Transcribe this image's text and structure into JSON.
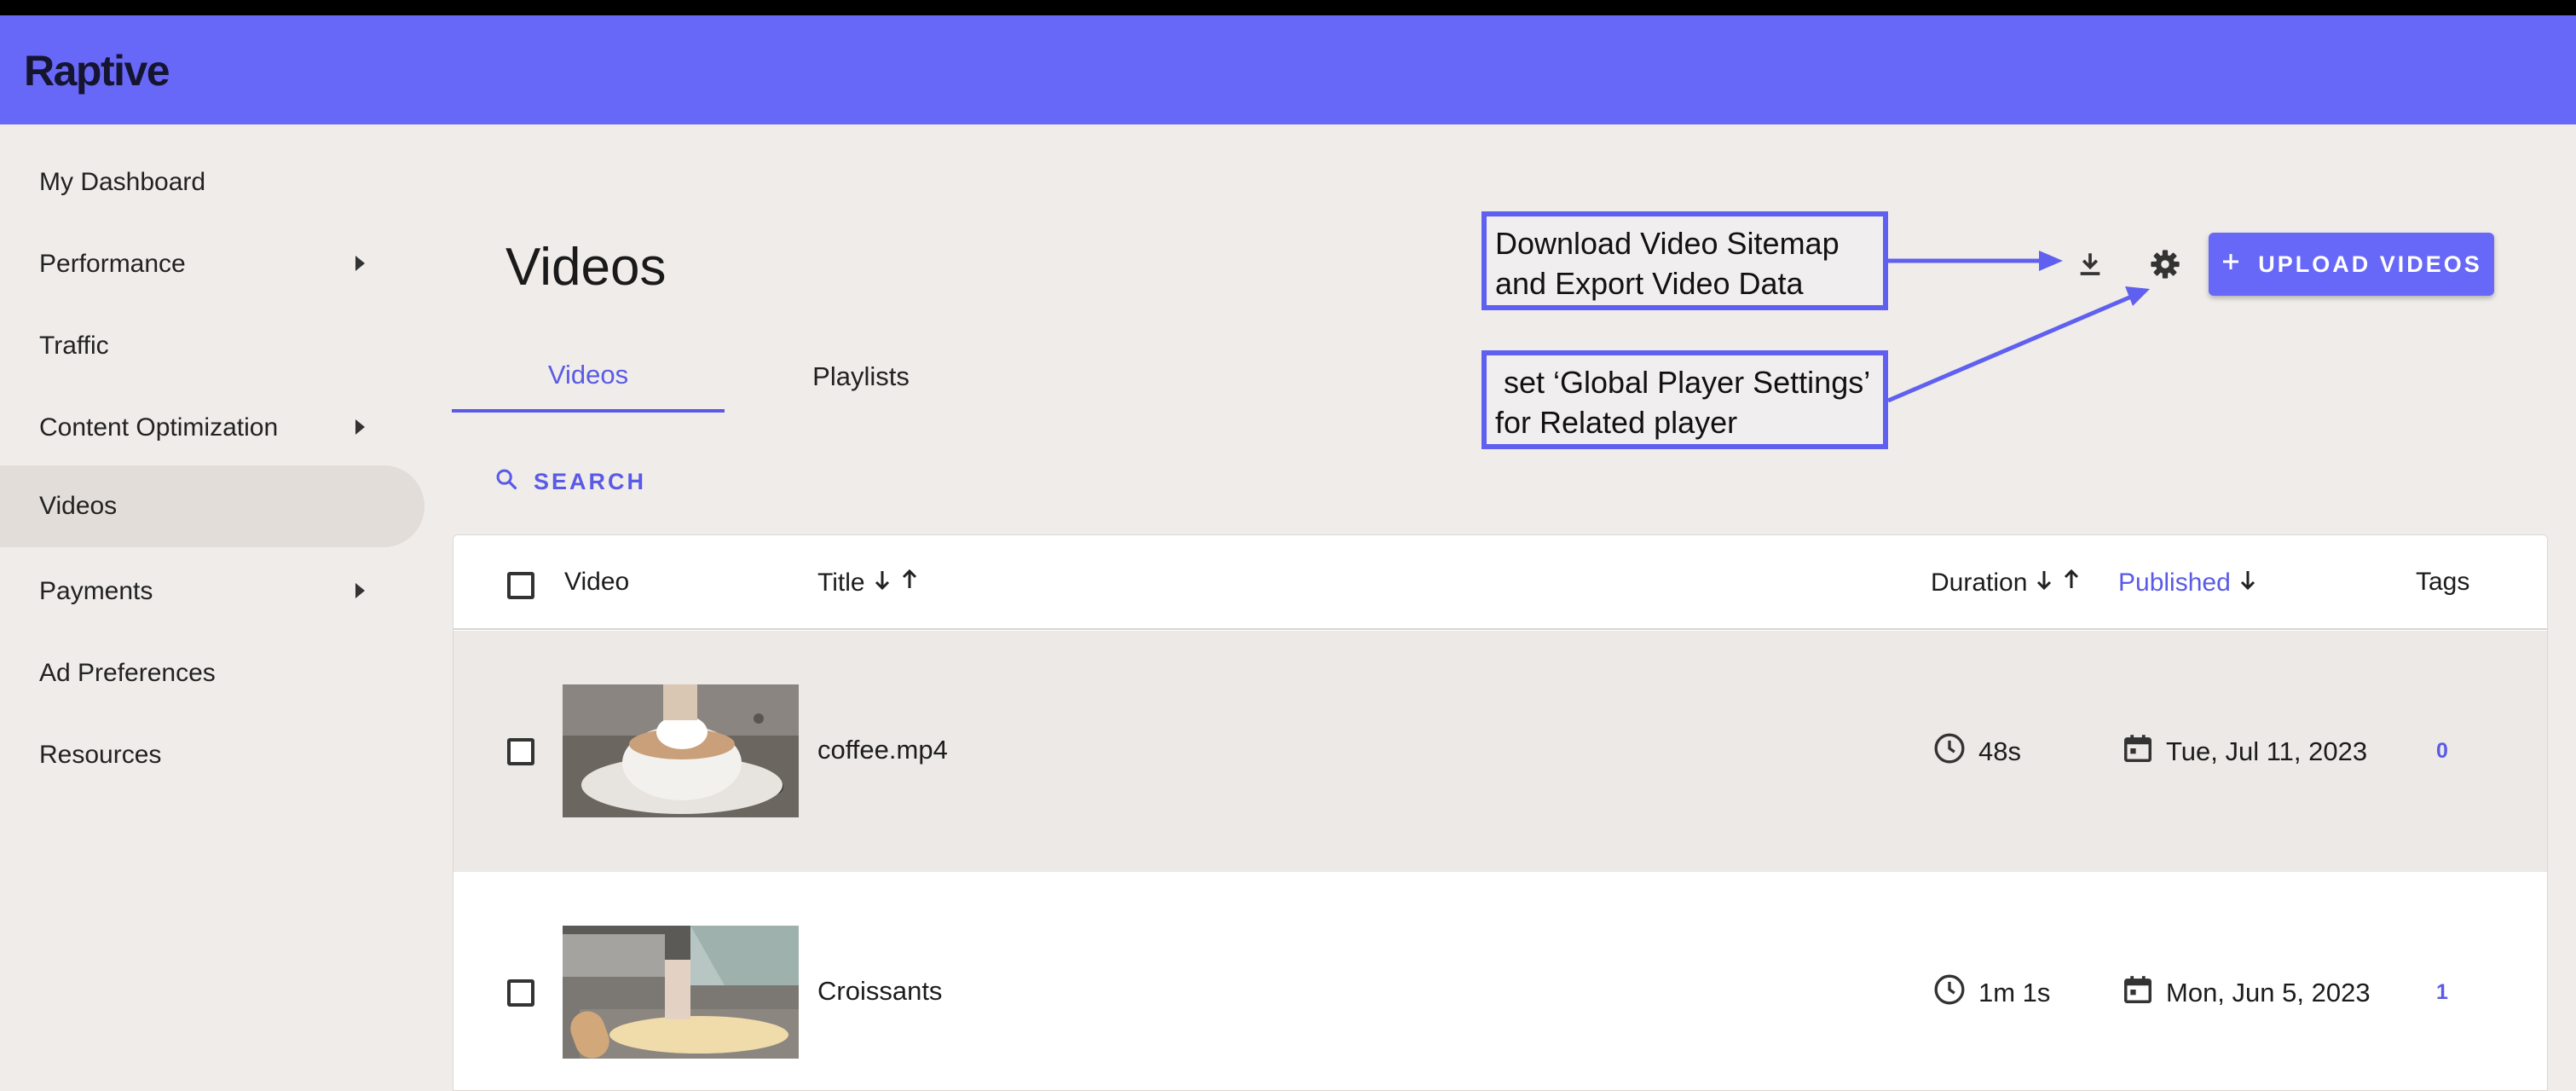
{
  "app": {
    "logo": "Raptive"
  },
  "sidebar": {
    "items": [
      {
        "label": "My Dashboard"
      },
      {
        "label": "Performance"
      },
      {
        "label": "Traffic"
      },
      {
        "label": "Content Optimization"
      },
      {
        "label": "Videos"
      },
      {
        "label": "Payments"
      },
      {
        "label": "Ad Preferences"
      },
      {
        "label": "Resources"
      }
    ],
    "active": "Videos"
  },
  "main": {
    "title": "Videos",
    "tabs": [
      {
        "label": "Videos"
      },
      {
        "label": "Playlists"
      }
    ],
    "search_label": "SEARCH",
    "upload_label": "UPLOAD VIDEOS"
  },
  "callouts": {
    "download": "Download Video Sitemap\nand Export Video Data",
    "settings": " set ‘Global Player Settings’\nfor Related player"
  },
  "table": {
    "headers": {
      "video": "Video",
      "title": "Title",
      "duration": "Duration",
      "published": "Published",
      "tags": "Tags"
    },
    "rows": [
      {
        "title": "coffee.mp4",
        "duration": "48s",
        "published": "Tue, Jul 11, 2023",
        "tags": "0"
      },
      {
        "title": "Croissants",
        "duration": "1m 1s",
        "published": "Mon, Jun 5, 2023",
        "tags": "1"
      }
    ]
  },
  "colors": {
    "accent": "#6868f8",
    "link": "#5a5ae6",
    "header_text": "#151531"
  },
  "icons": [
    "chevron-right-icon",
    "search-icon",
    "download-icon",
    "gear-icon",
    "plus-icon",
    "arrow-down-icon",
    "arrow-up-icon",
    "clock-icon",
    "calendar-icon",
    "checkbox-icon"
  ]
}
